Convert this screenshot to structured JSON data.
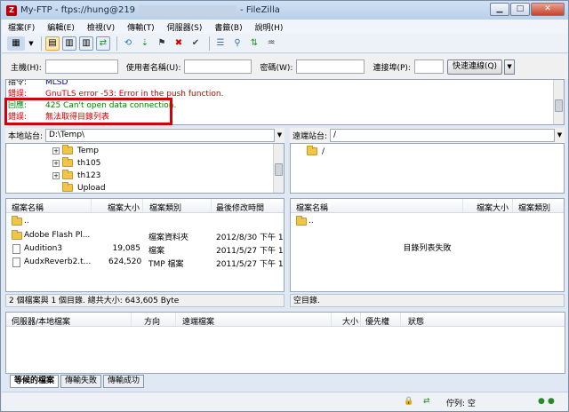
{
  "title": "My-FTP - ftps://hung@219",
  "title_suffix": "- FileZilla",
  "menu": [
    "檔案(F)",
    "編輯(E)",
    "檢視(V)",
    "傳輸(T)",
    "伺服器(S)",
    "書籤(B)",
    "說明(H)"
  ],
  "quickconnect": {
    "host_label": "主機(H):",
    "user_label": "使用者名稱(U):",
    "pass_label": "密碼(W):",
    "port_label": "連接埠(P):",
    "connect_button": "快速連線(Q)",
    "host_value": "",
    "user_value": "",
    "pass_value": "",
    "port_value": ""
  },
  "log": [
    {
      "k": "指令:",
      "v": "MLSD",
      "color": "#000080"
    },
    {
      "k": "錯誤:",
      "v": "GnuTLS error -53: Error in the push function.",
      "color": "#cc0000"
    },
    {
      "k": "回應:",
      "v": "425 Can't open data connection.",
      "color": "#008000"
    },
    {
      "k": "錯誤:",
      "v": "無法取得目錄列表",
      "color": "#cc0000"
    }
  ],
  "local": {
    "label": "本地站台:",
    "path": "D:\\Temp\\",
    "tree": [
      "Temp",
      "th105",
      "th123",
      "Upload"
    ],
    "headers": [
      "檔案名稱",
      "檔案大小",
      "檔案類別",
      "最後修改時間"
    ],
    "files": [
      {
        "name": "..",
        "size": "",
        "type": "",
        "date": ""
      },
      {
        "name": "Adobe Flash Pl...",
        "size": "",
        "type": "檔案資料夾",
        "date": "2012/8/30 下午 1..."
      },
      {
        "name": "Audition3",
        "size": "19,085",
        "type": "檔案",
        "date": "2011/5/27 下午 1..."
      },
      {
        "name": "AudxReverb2.t...",
        "size": "624,520",
        "type": "TMP 檔案",
        "date": "2011/5/27 下午 1..."
      }
    ],
    "status": "2 個檔案與 1 個目錄. 總共大小: 643,605 Byte"
  },
  "remote": {
    "label": "遠端站台:",
    "path": "/",
    "tree": [
      "/"
    ],
    "headers": [
      "檔案名稱",
      "檔案大小",
      "檔案類別"
    ],
    "files": [
      {
        "name": ".."
      }
    ],
    "message": "目錄列表失敗",
    "status": "空目錄."
  },
  "queue": {
    "headers": [
      "伺服器/本地檔案",
      "方向",
      "遠端檔案",
      "大小",
      "優先權",
      "狀態"
    ],
    "tabs": [
      "等候的檔案",
      "傳輸失敗",
      "傳輸成功"
    ]
  },
  "statusbar": {
    "queue_text": "佇列: 空"
  }
}
